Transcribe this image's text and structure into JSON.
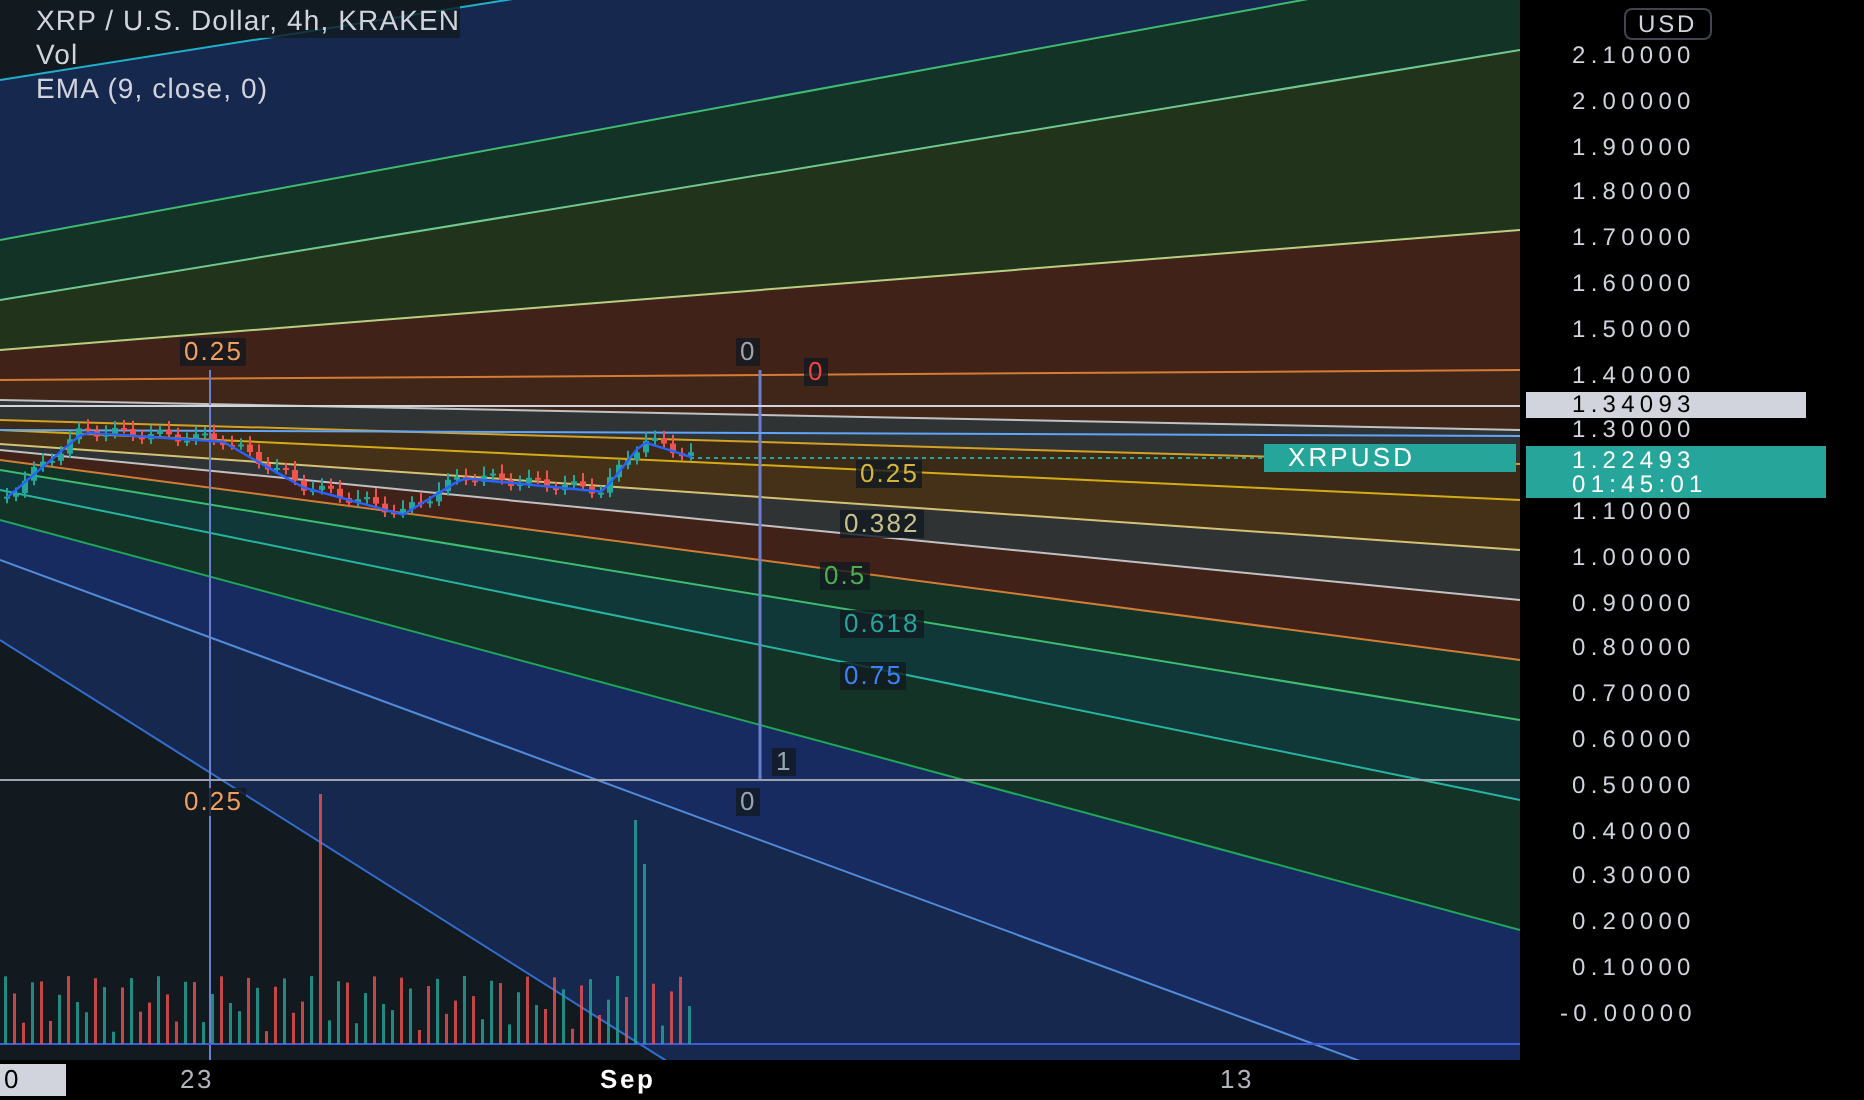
{
  "legend": {
    "title": "XRP / U.S. Dollar, 4h, KRAKEN",
    "indicators": [
      "Vol",
      "EMA (9, close, 0)"
    ]
  },
  "fib_labels": [
    "0.25",
    "0",
    "0",
    "0.25",
    "0.382",
    "0.5",
    "0.618",
    "0.75",
    "1",
    "0.25",
    "0"
  ],
  "price_axis": {
    "currency": "USD",
    "ticks": [
      "2.10000",
      "2.00000",
      "1.90000",
      "1.80000",
      "1.70000",
      "1.60000",
      "1.50000",
      "1.40000",
      "1.30000",
      "1.10000",
      "1.00000",
      "0.90000",
      "0.80000",
      "0.70000",
      "0.60000",
      "0.50000",
      "0.40000",
      "0.30000",
      "0.20000",
      "0.10000",
      "-0.00000"
    ]
  },
  "price_labels": {
    "line_price": "1.34093",
    "symbol": "XRPUSD",
    "last_price": "1.22493",
    "countdown": "01:45:01"
  },
  "time_axis": {
    "cursor_label": "0",
    "ticks": [
      {
        "text": "23",
        "bold": false
      },
      {
        "text": "Sep",
        "bold": true
      },
      {
        "text": "13",
        "bold": false
      }
    ]
  }
}
